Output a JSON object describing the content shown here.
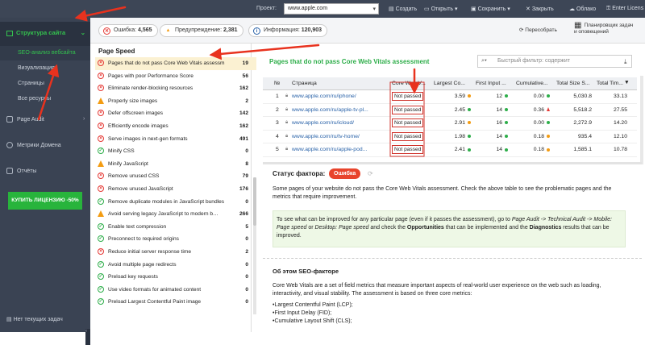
{
  "topbar": {
    "project_label": "Проект:",
    "project_value": "www.apple.com",
    "buttons": [
      {
        "label": "Создать",
        "icon": "new-file-icon"
      },
      {
        "label": "Открыть",
        "icon": "folder-open-icon"
      },
      {
        "label": "Сохранить",
        "icon": "save-icon"
      },
      {
        "label": "Закрыть",
        "icon": "close-icon"
      },
      {
        "label": "Облако",
        "icon": "cloud-icon"
      },
      {
        "label": "Enter Licens",
        "icon": "key-icon"
      }
    ]
  },
  "sidebar": {
    "main": "Структура сайта",
    "sub": [
      "SEO-анализ вебсайта",
      "Визуализация",
      "Страницы",
      "Все ресурсы"
    ],
    "sections": [
      "Page Audit",
      "Метрики Домена",
      "Отчёты"
    ],
    "buy": "КУПИТЬ ЛИЦЕНЗИЮ -50%",
    "footer": "Нет текущих задач"
  },
  "stats": {
    "errors": {
      "label": "Ошибка:",
      "value": "4,565"
    },
    "warnings": {
      "label": "Предупреждение:",
      "value": "2,381"
    },
    "info": {
      "label": "Информация:",
      "value": "120,903"
    },
    "rebuild": "Пересобрать",
    "scheduler_line1": "Планировщик задач",
    "scheduler_line2": "и оповещений"
  },
  "left_panel": {
    "title": "Page Speed",
    "items": [
      {
        "label": "Pages that do not pass Core Web Vitals assessm",
        "status": "err",
        "count": "19",
        "active": true
      },
      {
        "label": "Pages with poor Performance Score",
        "status": "err",
        "count": "56"
      },
      {
        "label": "Eliminate render-blocking resources",
        "status": "err",
        "count": "162"
      },
      {
        "label": "Properly size images",
        "status": "warn",
        "count": "2"
      },
      {
        "label": "Defer offscreen images",
        "status": "err",
        "count": "142"
      },
      {
        "label": "Efficiently encode images",
        "status": "err",
        "count": "162"
      },
      {
        "label": "Serve images in next-gen formats",
        "status": "err",
        "count": "491"
      },
      {
        "label": "Minify CSS",
        "status": "ok",
        "count": "0"
      },
      {
        "label": "Minify JavaScript",
        "status": "warn",
        "count": "8"
      },
      {
        "label": "Remove unused CSS",
        "status": "err",
        "count": "79"
      },
      {
        "label": "Remove unused JavaScript",
        "status": "err",
        "count": "176"
      },
      {
        "label": "Remove duplicate modules in JavaScript bundles",
        "status": "ok",
        "count": "0"
      },
      {
        "label": "Avoid serving legacy JavaScript to modern b…",
        "status": "warn",
        "count": "266"
      },
      {
        "label": "Enable text compression",
        "status": "ok",
        "count": "5"
      },
      {
        "label": "Preconnect to required origins",
        "status": "ok",
        "count": "0"
      },
      {
        "label": "Reduce initial server response time",
        "status": "err",
        "count": "2"
      },
      {
        "label": "Avoid multiple page redirects",
        "status": "ok",
        "count": "0"
      },
      {
        "label": "Preload key requests",
        "status": "ok",
        "count": "0"
      },
      {
        "label": "Use video formats for animated content",
        "status": "ok",
        "count": "0"
      },
      {
        "label": "Preload Largest Contentful Paint image",
        "status": "ok",
        "count": "0"
      }
    ]
  },
  "right": {
    "title": "Pages that do not pass Core Web Vitals assessment",
    "filter_placeholder": "Быстрый фильтр: содержит",
    "columns": [
      "№",
      "Страница",
      "Core Web V...",
      "Largest Co...",
      "First Input ...",
      "Cumulative...",
      "Total Size S...",
      "Total Tim..."
    ],
    "rows": [
      {
        "n": "1",
        "url": "www.apple.com/ru/iphone/",
        "cwv": "Not passed",
        "lcp": "3.59",
        "lcp_mark": "o",
        "fid": "12",
        "fid_mark": "g",
        "cls": "0.00",
        "cls_mark": "g",
        "size": "5,030.8",
        "time": "33.13"
      },
      {
        "n": "2",
        "url": "www.apple.com/ru/apple-tv-pl...",
        "cwv": "Not passed",
        "lcp": "2.45",
        "lcp_mark": "g",
        "fid": "14",
        "fid_mark": "g",
        "cls": "0.36",
        "cls_mark": "tri",
        "size": "5,518.2",
        "time": "27.55"
      },
      {
        "n": "3",
        "url": "www.apple.com/ru/icloud/",
        "cwv": "Not passed",
        "lcp": "2.91",
        "lcp_mark": "o",
        "fid": "16",
        "fid_mark": "g",
        "cls": "0.00",
        "cls_mark": "g",
        "size": "2,272.9",
        "time": "14.20"
      },
      {
        "n": "4",
        "url": "www.apple.com/ru/tv-home/",
        "cwv": "Not passed",
        "lcp": "1.98",
        "lcp_mark": "g",
        "fid": "14",
        "fid_mark": "g",
        "cls": "0.18",
        "cls_mark": "o",
        "size": "935.4",
        "time": "12.10"
      },
      {
        "n": "5",
        "url": "www.apple.com/ru/apple-pod...",
        "cwv": "Not passed",
        "lcp": "2.41",
        "lcp_mark": "g",
        "fid": "14",
        "fid_mark": "g",
        "cls": "0.18",
        "cls_mark": "o",
        "size": "1,585.1",
        "time": "10.78"
      }
    ],
    "factor_label": "Статус фактора:",
    "factor_badge": "Ошибка",
    "description": "Some pages of your website do not pass the Core Web Vitals assessment. Check the above table to see the problematic pages and the metrics that require improvement.",
    "tip_prefix": "To see what can be improved for any particular page (even if it passes the assessment), go to ",
    "tip_path1": "Page Audit -> Technical Audit -> Mobile: Page speed",
    "tip_or": " or ",
    "tip_path2": "Desktop: Page speed",
    "tip_mid": " and check the ",
    "tip_opp": "Opportunities",
    "tip_mid2": " that can be implemented and the ",
    "tip_diag": "Diagnostics",
    "tip_end": " results that can be improved.",
    "about_title": "Об этом SEO-факторе",
    "about_text": "Core Web Vitals are a set of field metrics that measure important aspects of real-world user experience on the web such as loading, interactivity, and visual stability. The assessment is based on three core metrics:",
    "metric1": "•Largest Contentful Paint (LCP);",
    "metric2": "•First Input Delay (FID);",
    "metric3": "•Cumulative Layout Shift (CLS);"
  }
}
